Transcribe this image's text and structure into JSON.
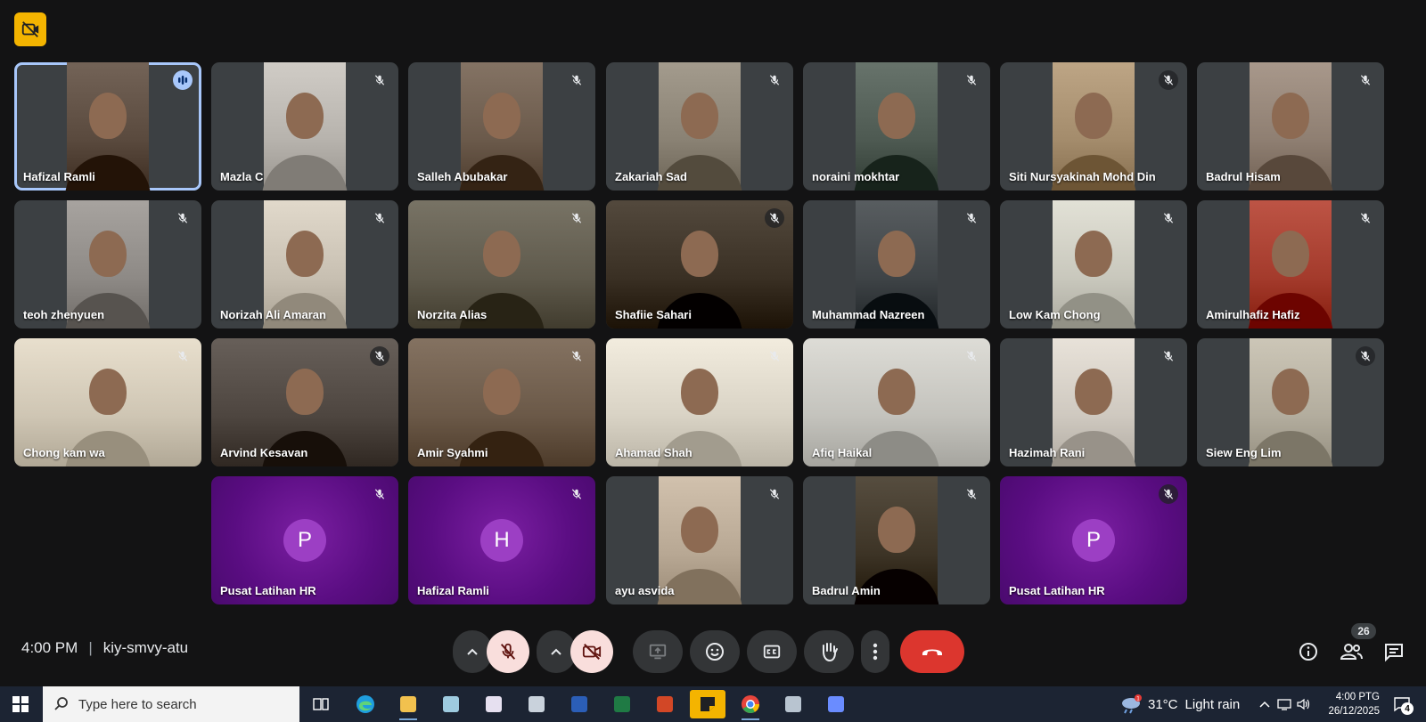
{
  "meeting": {
    "time": "4:00 PM",
    "separator": "|",
    "code": "kiy-smvy-atu",
    "participant_count": "26"
  },
  "participants": [
    {
      "name": "Hafizal Ramli",
      "type": "video",
      "bg": "#5a4a3e",
      "muted": false,
      "speaking": true
    },
    {
      "name": "Mazla C",
      "type": "video",
      "bg": "#b7b3ad",
      "muted": true
    },
    {
      "name": "Salleh Abubakar",
      "type": "video",
      "bg": "#6b5a4b",
      "muted": true
    },
    {
      "name": "Zakariah Sad",
      "type": "video",
      "bg": "#8a8274",
      "muted": true
    },
    {
      "name": "noraini mokhtar",
      "type": "video",
      "bg": "#4e5a52",
      "muted": true
    },
    {
      "name": "Siti Nursyakinah Mohd Din",
      "type": "video",
      "bg": "#a48c6c",
      "muted": true
    },
    {
      "name": "Badrul Hisam",
      "type": "video",
      "bg": "#8f7f72",
      "muted": true
    },
    {
      "name": "teoh zhenyuen",
      "type": "video",
      "bg": "#8e8a86",
      "muted": true
    },
    {
      "name": "Norizah Ali Amaran",
      "type": "video",
      "bg": "#c8c0b2",
      "muted": true
    },
    {
      "name": "Norzita Alias",
      "type": "video",
      "bg": "#5f5a4c",
      "muted": true
    },
    {
      "name": "Shafiie Sahari",
      "type": "video",
      "bg": "#3a3024",
      "muted": true
    },
    {
      "name": "Muhammad Nazreen",
      "type": "video",
      "bg": "#3f4447",
      "muted": true
    },
    {
      "name": "Low Kam Chong",
      "type": "video",
      "bg": "#c9c8bd",
      "muted": true
    },
    {
      "name": "Amirulhafiz Hafiz",
      "type": "video",
      "bg": "#a43b2c",
      "muted": true
    },
    {
      "name": "Chong kam wa",
      "type": "video",
      "bg": "#cfc6b4",
      "muted": true
    },
    {
      "name": "Arvind Kesavan",
      "type": "video",
      "bg": "#4e4640",
      "muted": true
    },
    {
      "name": "Amir Syahmi",
      "type": "video",
      "bg": "#6b5948",
      "muted": true
    },
    {
      "name": "Ahamad Shah",
      "type": "video",
      "bg": "#d9d3c5",
      "muted": true
    },
    {
      "name": "Afiq Haikal",
      "type": "video",
      "bg": "#c4c3bd",
      "muted": true
    },
    {
      "name": "Hazimah Rani",
      "type": "video",
      "bg": "#cfc9c0",
      "muted": true
    },
    {
      "name": "Siew Eng Lim",
      "type": "video",
      "bg": "#b3ad9e",
      "muted": true
    },
    {
      "name": "Pusat Latihan HR",
      "type": "avatar",
      "initial": "P",
      "muted": true
    },
    {
      "name": "Hafizal Ramli",
      "type": "avatar",
      "initial": "H",
      "muted": true
    },
    {
      "name": "ayu asvida",
      "type": "video",
      "bg": "#b8a894",
      "muted": true
    },
    {
      "name": "Badrul Amin",
      "type": "video",
      "bg": "#3d3426",
      "muted": true
    },
    {
      "name": "Pusat Latihan HR",
      "type": "avatar",
      "initial": "P",
      "muted": true
    }
  ],
  "controls": [
    {
      "name": "mic-options-chevron",
      "icon": "chevron-up-icon",
      "style": "dark"
    },
    {
      "name": "mic-toggle-button",
      "icon": "mic-off-icon",
      "style": "pink"
    },
    {
      "name": "camera-options-chevron",
      "icon": "chevron-up-icon",
      "style": "dark"
    },
    {
      "name": "camera-toggle-button",
      "icon": "camera-off-icon",
      "style": "pink"
    },
    {
      "name": "present-button",
      "icon": "present-icon",
      "style": "dark"
    },
    {
      "name": "reactions-button",
      "icon": "emoji-icon",
      "style": "dark"
    },
    {
      "name": "captions-button",
      "icon": "captions-icon",
      "style": "dark"
    },
    {
      "name": "raise-hand-button",
      "icon": "hand-icon",
      "style": "dark"
    },
    {
      "name": "more-options-button",
      "icon": "more-vert-icon",
      "style": "dark"
    },
    {
      "name": "leave-call-button",
      "icon": "phone-hangup-icon",
      "style": "red"
    }
  ],
  "taskbar": {
    "search_placeholder": "Type here to search",
    "apps": [
      "task-view-icon",
      "edge-icon",
      "file-explorer-icon",
      "app-blue-icon",
      "app-colorful-icon",
      "app-printer-icon",
      "word-icon",
      "excel-icon",
      "powerpoint-icon",
      "sticky-notes-icon",
      "chrome-icon",
      "app-monitor-icon",
      "copilot-icon"
    ],
    "active_app": "sticky-notes-icon",
    "weather_temp": "31°C",
    "weather_condition": "Light rain",
    "weather_badge": "1",
    "clock_time": "4:00 PTG",
    "clock_date": "26/12/2025",
    "notification_count": "4"
  },
  "colors": {
    "background": "#131314",
    "tile": "#3c4043",
    "active_outline": "#a8c7fa",
    "avatar_purple": "#9c3fc4",
    "leave_red": "#dc362e",
    "pink_button": "#f9dedc"
  }
}
